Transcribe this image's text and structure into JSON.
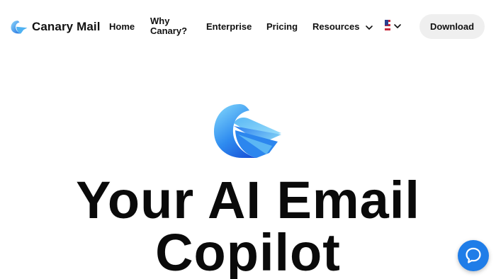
{
  "header": {
    "brand_name": "Canary Mail",
    "nav": {
      "home": "Home",
      "why": "Why Canary?",
      "enterprise": "Enterprise",
      "pricing": "Pricing",
      "resources": "Resources"
    },
    "language_icon": "us-flag-icon",
    "download_label": "Download"
  },
  "hero": {
    "headline": "Your AI Email Copilot"
  },
  "colors": {
    "brand_blue": "#1f7de8",
    "logo_light": "#7ccdf5",
    "button_bg": "#efefef"
  }
}
